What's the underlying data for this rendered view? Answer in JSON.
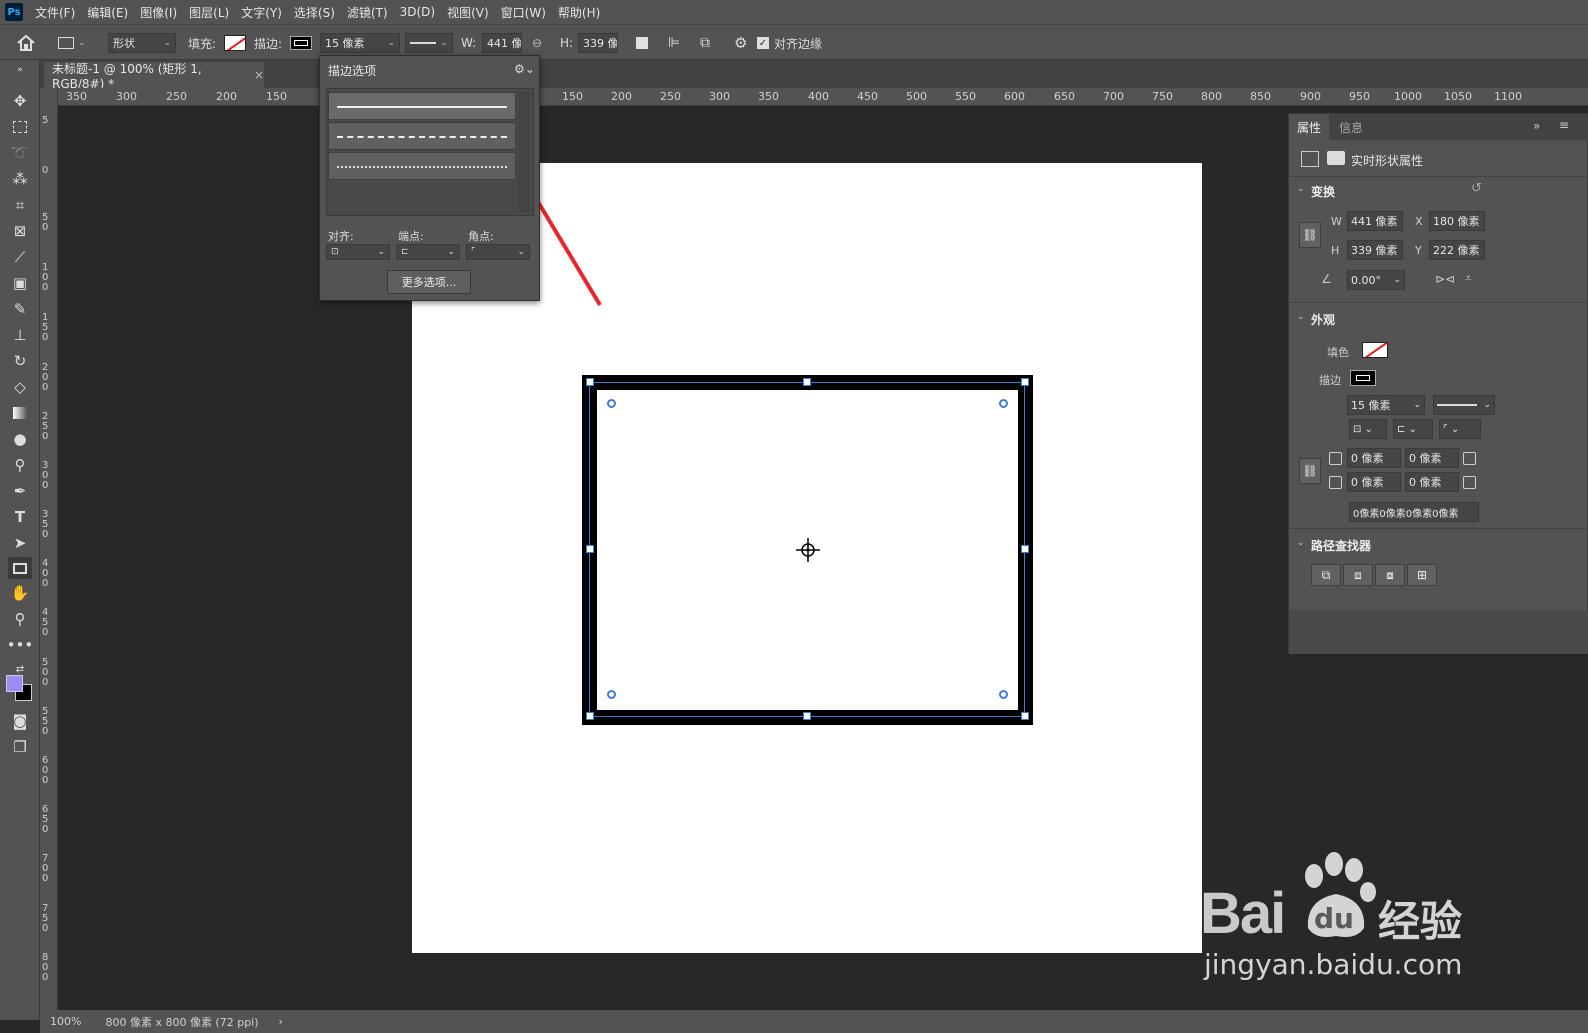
{
  "app": {
    "logo": "Ps"
  },
  "menu": [
    "文件(F)",
    "编辑(E)",
    "图像(I)",
    "图层(L)",
    "文字(Y)",
    "选择(S)",
    "滤镜(T)",
    "3D(D)",
    "视图(V)",
    "窗口(W)",
    "帮助(H)"
  ],
  "options": {
    "mode": "形状",
    "fill_label": "填充:",
    "stroke_label": "描边:",
    "stroke_width": "15 像素",
    "w_label": "W:",
    "w_value": "441 像素",
    "h_label": "H:",
    "h_value": "339 像素",
    "align_edges": "对齐边缘"
  },
  "document": {
    "tab_title": "未标题-1 @ 100% (矩形 1, RGB/8#) *",
    "close": "×"
  },
  "ruler_top": [
    "350",
    "300",
    "250",
    "200",
    "150",
    "150",
    "200",
    "250",
    "300",
    "350",
    "400",
    "450",
    "500",
    "550",
    "600",
    "650",
    "700",
    "750",
    "800",
    "850",
    "900",
    "950",
    "1000",
    "1050",
    "1100"
  ],
  "ruler_left": [
    "5",
    "0",
    "5\n0",
    "1\n0\n0",
    "1\n5\n0",
    "2\n0\n0",
    "2\n5\n0",
    "3\n0\n0",
    "3\n5\n0",
    "4\n0\n0",
    "4\n5\n0",
    "5\n0\n0",
    "5\n5\n0",
    "6\n0\n0",
    "6\n5\n0",
    "7\n0\n0",
    "7\n5\n0",
    "8\n0\n0"
  ],
  "stroke_popup": {
    "title": "描边选项",
    "align_label": "对齐:",
    "caps_label": "端点:",
    "corners_label": "角点:",
    "more_button": "更多选项..."
  },
  "properties": {
    "tabs": [
      "属性",
      "信息"
    ],
    "header": "实时形状属性",
    "transform": {
      "title": "变换",
      "w_label": "W",
      "w": "441 像素",
      "x_label": "X",
      "x": "180 像素",
      "h_label": "H",
      "h": "339 像素",
      "y_label": "Y",
      "y": "222 像素",
      "angle": "0.00°"
    },
    "appearance": {
      "title": "外观",
      "fill_label": "填色",
      "stroke_label": "描边",
      "stroke_width": "15 像素",
      "corner_tl": "0 像素",
      "corner_tr": "0 像素",
      "corner_bl": "0 像素",
      "corner_br": "0 像素",
      "corners_summary": "0像素0像素0像素0像素"
    },
    "pathfinder": {
      "title": "路径查找器"
    }
  },
  "status": {
    "zoom": "100%",
    "doc_info": "800 像素 x 800 像素 (72 ppi)",
    "arrow": "›"
  },
  "watermark": {
    "brand": "Bai",
    "brand2": "du",
    "site_cn": "经验",
    "url": "jingyan.baidu.com"
  },
  "colors": {
    "foreground": "#9b8cf5",
    "background": "#000000",
    "path": "#3b7cd8",
    "arrow": "#e8262c"
  }
}
